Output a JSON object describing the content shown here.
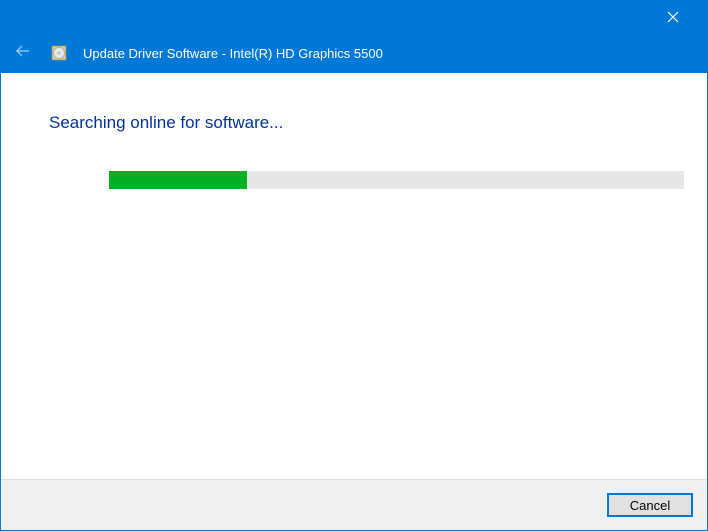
{
  "titlebar": {
    "close_icon": "close"
  },
  "header": {
    "back_icon": "back-arrow",
    "disc_icon": "driver-disc",
    "title": "Update Driver Software - Intel(R) HD Graphics 5500"
  },
  "content": {
    "status_text": "Searching online for software...",
    "progress_percent": 24
  },
  "footer": {
    "cancel_label": "Cancel"
  }
}
